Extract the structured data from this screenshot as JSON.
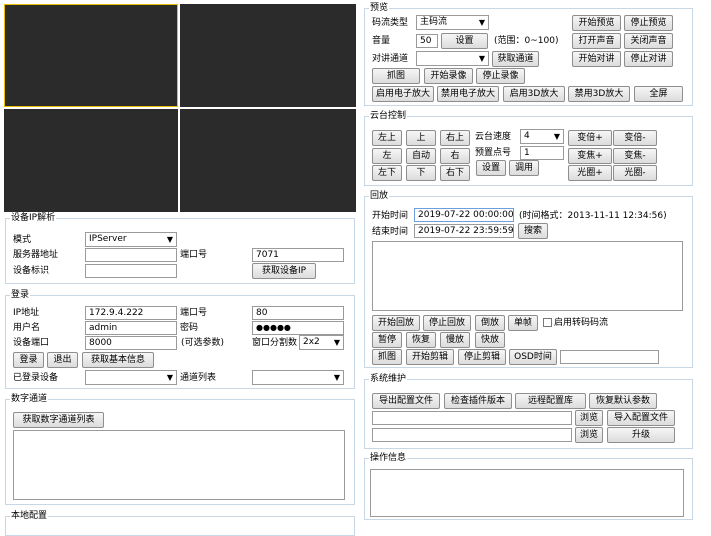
{
  "device": {
    "title": "设备IP解析",
    "mode_label": "模式",
    "mode_value": "IPServer",
    "server_addr_label": "服务器地址",
    "server_addr_value": "",
    "port_label": "端口号",
    "port_value": "7071",
    "device_id_label": "设备标识",
    "device_id_value": "",
    "get_ip_btn": "获取设备IP"
  },
  "login": {
    "title": "登录",
    "ip_label": "IP地址",
    "ip_value": "172.9.4.222",
    "port_label": "端口号",
    "port_value": "80",
    "user_label": "用户名",
    "user_value": "admin",
    "pwd_label": "密码",
    "pwd_value": "●●●●●",
    "dev_port_label": "设备端口",
    "dev_port_value": "8000",
    "optional_note": "(可选参数)",
    "split_label": "窗口分割数",
    "split_value": "2x2",
    "login_btn": "登录",
    "logout_btn": "退出",
    "basic_info_btn": "获取基本信息",
    "logged_label": "已登录设备",
    "logged_value": "",
    "channel_label": "通道列表",
    "channel_value": ""
  },
  "digital": {
    "title": "数字通道",
    "get_list_btn": "获取数字通道列表"
  },
  "local": {
    "title": "本地配置"
  },
  "preview": {
    "title": "预览",
    "stream_label": "码流类型",
    "stream_value": "主码流",
    "volume_label": "音量",
    "volume_value": "50",
    "set_btn": "设置",
    "range_note": "(范围：0~100)",
    "talk_label": "对讲通道",
    "talk_value": "",
    "get_channel_btn": "获取通道",
    "start_preview": "开始预览",
    "stop_preview": "停止预览",
    "open_sound": "打开声音",
    "close_sound": "关闭声音",
    "start_talk": "开始对讲",
    "stop_talk": "停止对讲",
    "capture": "抓图",
    "start_record": "开始录像",
    "stop_record": "停止录像",
    "ezoom_on": "启用电子放大",
    "ezoom_off": "禁用电子放大",
    "zoom3d_on": "启用3D放大",
    "zoom3d_off": "禁用3D放大",
    "fullscreen": "全屏"
  },
  "ptz": {
    "title": "云台控制",
    "up_left": "左上",
    "up": "上",
    "up_right": "右上",
    "left": "左",
    "auto": "自动",
    "right": "右",
    "down_left": "左下",
    "down": "下",
    "down_right": "右下",
    "speed_label": "云台速度",
    "speed_value": "4",
    "preset_label": "预置点号",
    "preset_value": "1",
    "set_btn": "设置",
    "call_btn": "调用",
    "zoom_in": "变倍+",
    "zoom_out": "变倍-",
    "focus_in": "变焦+",
    "focus_out": "变焦-",
    "iris_in": "光圈+",
    "iris_out": "光圈-"
  },
  "playback": {
    "title": "回放",
    "start_label": "开始时间",
    "start_value": "2019-07-22 00:00:00",
    "format_note": "(时间格式：2013-11-11 12:34:56)",
    "end_label": "结束时间",
    "end_value": "2019-07-22 23:59:59",
    "search_btn": "搜索",
    "start_play": "开始回放",
    "stop_play": "停止回放",
    "reverse": "倒放",
    "single_frame": "单帧",
    "transcode_label": "启用转码码流",
    "pause": "暂停",
    "resume": "恢复",
    "slow": "慢放",
    "fast": "快放",
    "capture": "抓图",
    "start_clip": "开始剪辑",
    "stop_clip": "停止剪辑",
    "osd_time": "OSD时间",
    "osd_value": ""
  },
  "maintenance": {
    "title": "系统维护",
    "export_config": "导出配置文件",
    "check_plugin": "检查插件版本",
    "remote_config": "远程配置库",
    "restore_default": "恢复默认参数",
    "path1_value": "",
    "browse1": "浏览",
    "import_config": "导入配置文件",
    "path2_value": "",
    "browse2": "浏览",
    "upgrade": "升级"
  },
  "ops": {
    "title": "操作信息"
  },
  "colors": {
    "video_bg": "#2b2b2b",
    "selected_border": "#e8c000",
    "group_border": "#c7d7e6"
  }
}
